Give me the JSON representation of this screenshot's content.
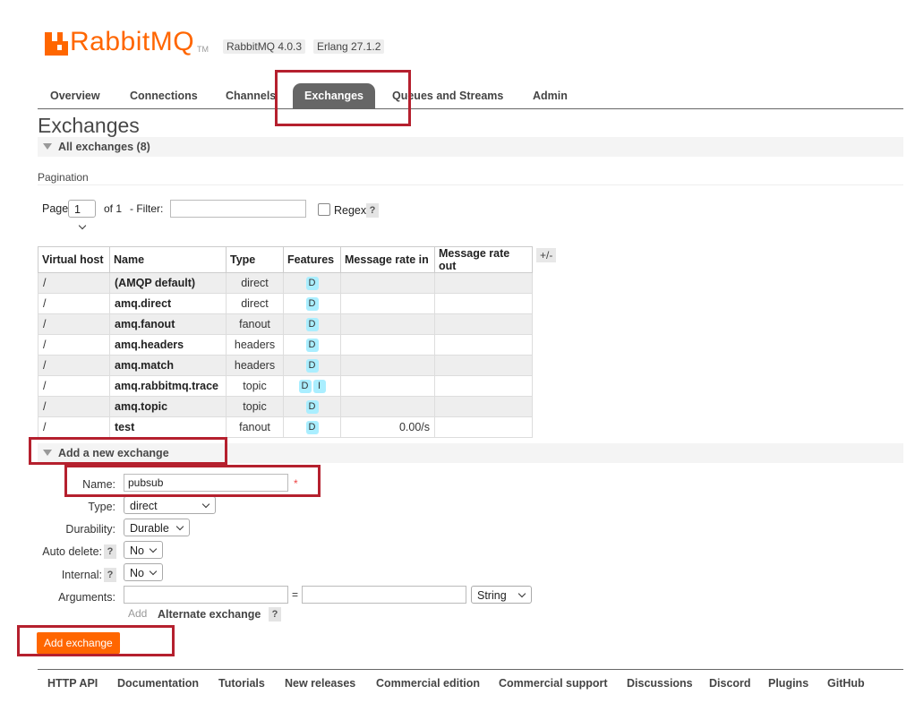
{
  "header": {
    "logo_text": "RabbitMQ",
    "logo_tm": "TM",
    "version": "RabbitMQ 4.0.3",
    "erlang": "Erlang 27.1.2"
  },
  "nav": {
    "tabs": [
      {
        "label": "Overview"
      },
      {
        "label": "Connections"
      },
      {
        "label": "Channels"
      },
      {
        "label": "Exchanges"
      },
      {
        "label": "Queues and Streams"
      },
      {
        "label": "Admin"
      }
    ],
    "active": "Exchanges"
  },
  "page": {
    "title": "Exchanges",
    "all_section": "All exchanges (8)"
  },
  "pagination": {
    "label": "Pagination",
    "page_label": "Page",
    "page_value": "1",
    "of_label": "of 1",
    "filter_label": "- Filter:",
    "filter_value": "",
    "regex_label": "Regex",
    "help": "?"
  },
  "table": {
    "headers": [
      "Virtual host",
      "Name",
      "Type",
      "Features",
      "Message rate in",
      "Message rate out"
    ],
    "toggle": "+/-",
    "rows": [
      {
        "vhost": "/",
        "name": "(AMQP default)",
        "type": "direct",
        "features": [
          "D"
        ],
        "rate_in": "",
        "rate_out": ""
      },
      {
        "vhost": "/",
        "name": "amq.direct",
        "type": "direct",
        "features": [
          "D"
        ],
        "rate_in": "",
        "rate_out": ""
      },
      {
        "vhost": "/",
        "name": "amq.fanout",
        "type": "fanout",
        "features": [
          "D"
        ],
        "rate_in": "",
        "rate_out": ""
      },
      {
        "vhost": "/",
        "name": "amq.headers",
        "type": "headers",
        "features": [
          "D"
        ],
        "rate_in": "",
        "rate_out": ""
      },
      {
        "vhost": "/",
        "name": "amq.match",
        "type": "headers",
        "features": [
          "D"
        ],
        "rate_in": "",
        "rate_out": ""
      },
      {
        "vhost": "/",
        "name": "amq.rabbitmq.trace",
        "type": "topic",
        "features": [
          "D",
          "I"
        ],
        "rate_in": "",
        "rate_out": ""
      },
      {
        "vhost": "/",
        "name": "amq.topic",
        "type": "topic",
        "features": [
          "D"
        ],
        "rate_in": "",
        "rate_out": ""
      },
      {
        "vhost": "/",
        "name": "test",
        "type": "fanout",
        "features": [
          "D"
        ],
        "rate_in": "0.00/s",
        "rate_out": ""
      }
    ]
  },
  "add_form": {
    "section": "Add a new exchange",
    "name_label": "Name:",
    "name_value": "pubsub",
    "required_mark": "*",
    "type_label": "Type:",
    "type_value": "direct",
    "durability_label": "Durability:",
    "durability_value": "Durable",
    "auto_delete_label": "Auto delete:",
    "auto_delete_value": "No",
    "internal_label": "Internal:",
    "internal_value": "No",
    "arguments_label": "Arguments:",
    "equals": "=",
    "arg_type_value": "String",
    "add_link": "Add",
    "alternate_exchange": "Alternate exchange",
    "help": "?",
    "submit": "Add exchange"
  },
  "footer": {
    "links": [
      "HTTP API",
      "Documentation",
      "Tutorials",
      "New releases",
      "Commercial edition",
      "Commercial support",
      "Discussions",
      "Discord",
      "Plugins",
      "GitHub"
    ]
  },
  "colors": {
    "brand": "#ff6600",
    "highlight": "#b5202e",
    "active_tab": "#666666",
    "feature_badge": "#aaeeff"
  }
}
